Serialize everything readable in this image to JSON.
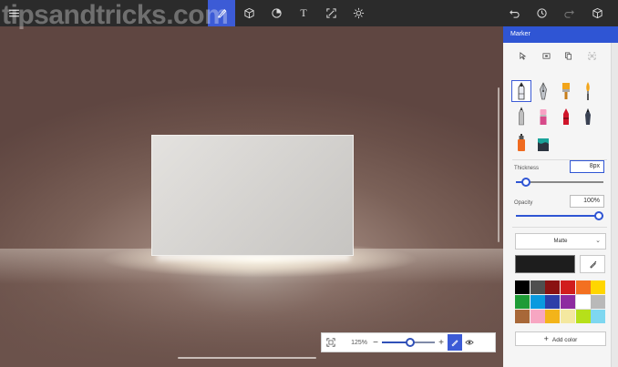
{
  "watermark": "tipsandtricks.com",
  "toolbar": {
    "buttons": [
      {
        "name": "menu-icon"
      },
      {
        "name": "brush-icon",
        "active": true
      },
      {
        "name": "3d-shapes-icon"
      },
      {
        "name": "stickers-icon"
      },
      {
        "name": "text-icon",
        "glyph": "T"
      },
      {
        "name": "canvas-icon"
      },
      {
        "name": "effects-icon"
      },
      {
        "name": "undo-icon"
      },
      {
        "name": "history-icon"
      },
      {
        "name": "redo-icon"
      },
      {
        "name": "3d-view-icon"
      }
    ]
  },
  "panel": {
    "title": "Marker",
    "brushes": [
      {
        "name": "marker",
        "selected": true
      },
      {
        "name": "calligraphy-pen"
      },
      {
        "name": "oil-brush"
      },
      {
        "name": "watercolor"
      },
      {
        "name": "pencil"
      },
      {
        "name": "eraser"
      },
      {
        "name": "crayon"
      },
      {
        "name": "pixel-pen"
      },
      {
        "name": "spray-can"
      },
      {
        "name": "fill"
      }
    ],
    "thickness": {
      "label": "Thickness",
      "value": "8px",
      "level": 0.07
    },
    "opacity": {
      "label": "Opacity",
      "value": "100%",
      "level": 1.0
    },
    "finish": {
      "selected": "Matte"
    },
    "current_color": "#1d1d1d",
    "palette": [
      "#000000",
      "#4f4f4f",
      "#8a1212",
      "#d11d1d",
      "#f37021",
      "#ffd600",
      "#1e9b36",
      "#0a9adf",
      "#2e3fa8",
      "#8e2ba0",
      "#ffffff",
      "#b9b9b9",
      "#a86838",
      "#f7a6c2",
      "#f3b41a",
      "#f4e8a0",
      "#b6e01a",
      "#7ed7f0"
    ],
    "add_color_label": "Add color"
  },
  "zoom": {
    "percent": "125%",
    "level": 0.55
  },
  "accent": "#3c5bd6"
}
